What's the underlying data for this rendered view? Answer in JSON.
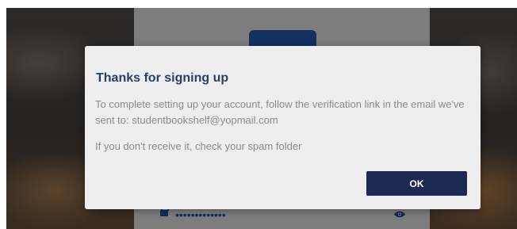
{
  "dialog": {
    "title": "Thanks for signing up",
    "message_line1": "To complete setting up your account, follow the verification link in the email we've sent to: studentbookshelf@yopmail.com",
    "message_line2": "If you don't receive it, check your spam folder",
    "ok_label": "OK"
  },
  "background_form": {
    "password_masked": "•••••••••••••"
  },
  "colors": {
    "title": "#2a3f5f",
    "button": "#1c2953",
    "dialog_bg": "#eeeeee",
    "text_muted": "#8a8a8a"
  },
  "icons": {
    "lock": "lock-icon",
    "eye": "eye-icon"
  }
}
